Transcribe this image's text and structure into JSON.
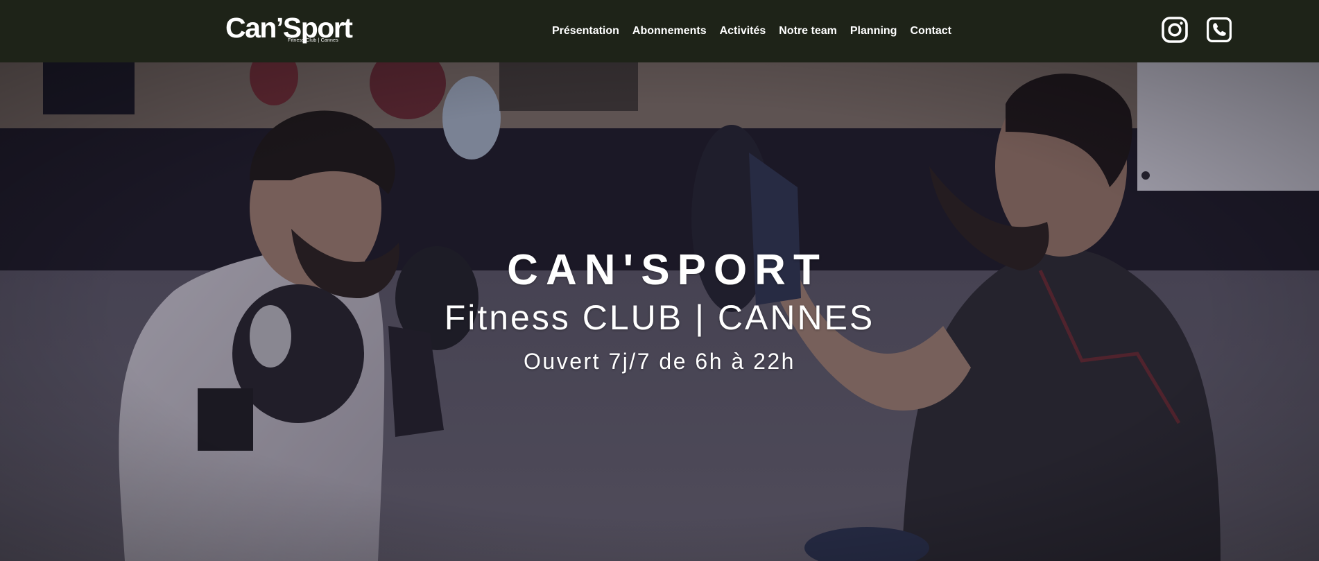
{
  "header": {
    "logo_text": "Can’Sport",
    "logo_subtext": "Fitness Club | Cannes",
    "nav": [
      {
        "label": "Présentation"
      },
      {
        "label": "Abonnements"
      },
      {
        "label": "Activités"
      },
      {
        "label": "Notre team"
      },
      {
        "label": "Planning"
      },
      {
        "label": "Contact"
      }
    ],
    "social": [
      {
        "icon": "instagram-icon"
      },
      {
        "icon": "phone-icon"
      }
    ]
  },
  "hero": {
    "title": "CAN'SPORT",
    "subtitle": "Fitness CLUB | CANNES",
    "hours": "Ouvert 7j/7 de 6h à 22h"
  },
  "colors": {
    "header_bg": "#1e2318",
    "text": "#ffffff"
  }
}
